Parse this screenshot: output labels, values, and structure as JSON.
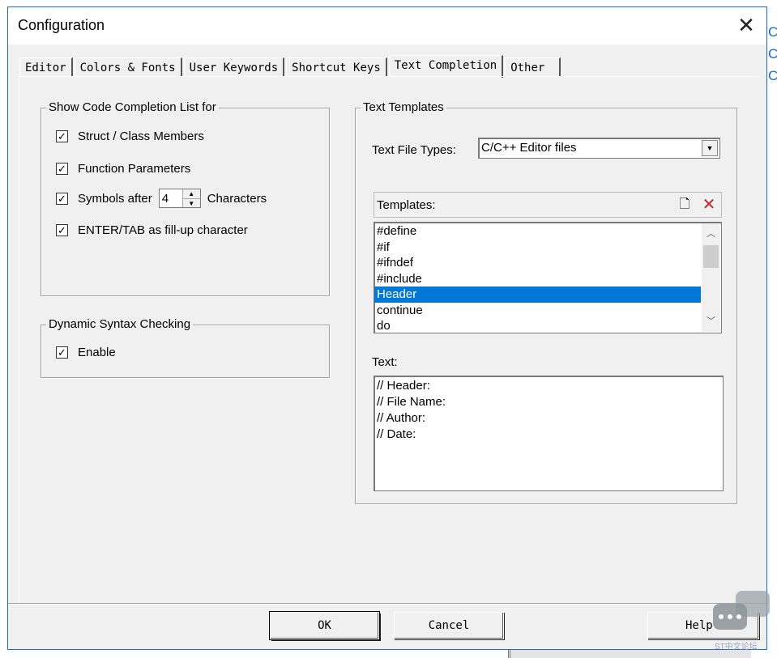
{
  "window": {
    "title": "Configuration"
  },
  "right_peek": [
    "C",
    "C",
    "C"
  ],
  "tabs": [
    {
      "label": "Editor",
      "active": false
    },
    {
      "label": "Colors & Fonts",
      "active": false
    },
    {
      "label": "User Keywords",
      "active": false
    },
    {
      "label": "Shortcut Keys",
      "active": false
    },
    {
      "label": "Text Completion",
      "active": true
    },
    {
      "label": "Other",
      "active": false
    }
  ],
  "code_completion": {
    "title": "Show Code Completion List for",
    "struct_members": {
      "label": "Struct / Class Members",
      "checked": true
    },
    "function_params": {
      "label": "Function Parameters",
      "checked": true
    },
    "symbols_after": {
      "label_before": "Symbols after",
      "value": "4",
      "label_after": "Characters",
      "checked": true
    },
    "enter_tab": {
      "label": "ENTER/TAB as fill-up character",
      "checked": true
    }
  },
  "syntax_checking": {
    "title": "Dynamic Syntax Checking",
    "enable": {
      "label": "Enable",
      "checked": true
    }
  },
  "text_templates": {
    "title": "Text Templates",
    "file_types_label": "Text File Types:",
    "file_types_value": "C/C++ Editor files",
    "templates_label": "Templates:",
    "items": [
      "#define",
      "#if",
      "#ifndef",
      "#include",
      "Header",
      "continue",
      "do"
    ],
    "selected_index": 4,
    "text_label": "Text:",
    "text_lines": [
      "// Header:",
      "// File Name:",
      "// Author:",
      "// Date:"
    ]
  },
  "buttons": {
    "ok": "OK",
    "cancel": "Cancel",
    "help": "Help"
  },
  "watermark": {
    "text": "ST中文论坛"
  },
  "colors": {
    "selection": "#0078d7",
    "window_bg": "#f0f0f0",
    "border_accent": "#1e6ac8",
    "delete_icon": "#c0282d"
  }
}
